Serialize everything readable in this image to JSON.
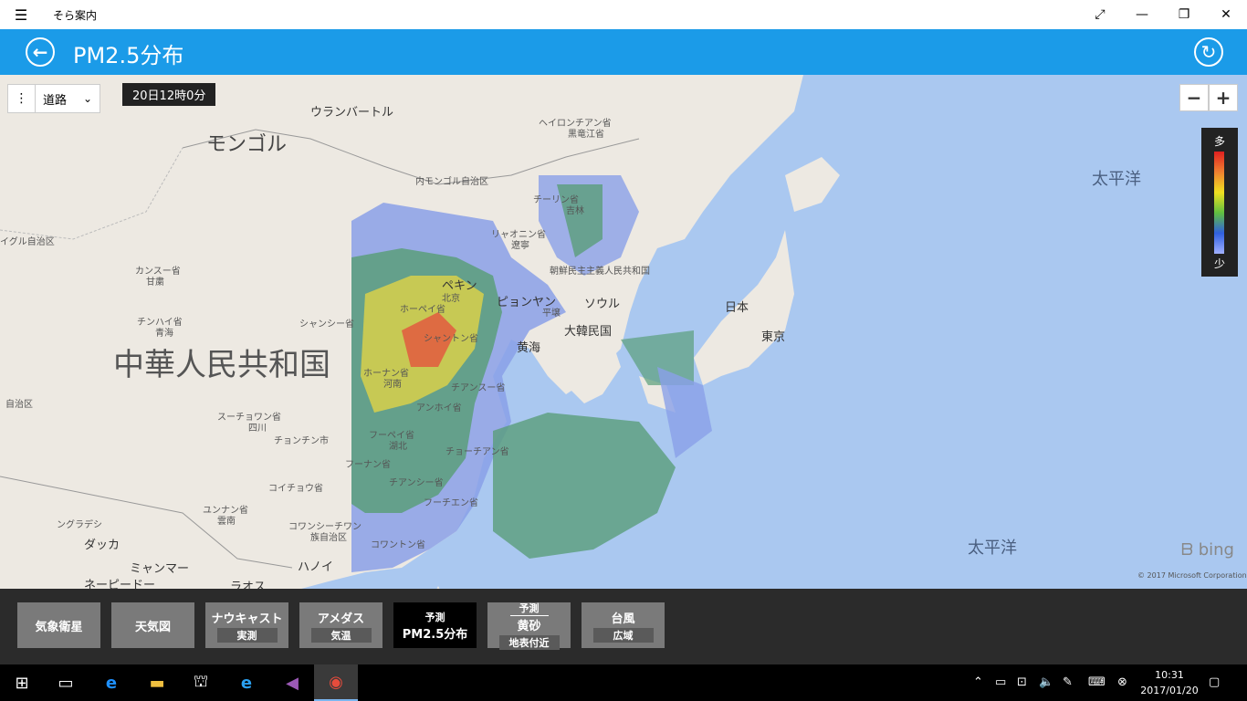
{
  "titlebar": {
    "app_name": "そら案内",
    "menu_icon": "hamburger-icon"
  },
  "header": {
    "title": "PM2.5分布"
  },
  "map": {
    "layer_select": "道路",
    "timestamp": "20日12時0分",
    "zoom_out": "−",
    "zoom_in": "+",
    "legend": {
      "high": "多",
      "low": "少"
    },
    "bing": "bing",
    "copyright": "© 2017 Microsoft Corporation",
    "labels": {
      "mongolia": "モンゴル",
      "ulaanbaatar": "ウランバートル",
      "heilongjiang": "ヘイロンチアン省",
      "heilongjiang_zh": "黒竜江省",
      "inner_mongolia": "内モンゴル自治区",
      "xinjiang": "イグル自治区",
      "gansu": "カンスー省",
      "gansu_zh": "甘粛",
      "qinghai": "チンハイ省",
      "qinghai_zh": "青海",
      "shanxi": "シャンシー省",
      "china": "中華人民共和国",
      "tibet": "自治区",
      "sichuan": "スーチョワン省",
      "sichuan_zh": "四川",
      "chongqing": "チョンチン市",
      "guizhou": "コイチョウ省",
      "yunnan": "ユンナン省",
      "yunnan_zh": "雲南",
      "guangxi": "コワンシーチワン",
      "guangxi_zh": "族自治区",
      "guangdong": "コワントン省",
      "bangladesh": "ングラデシ",
      "dhaka": "ダッカ",
      "myanmar": "ミャンマー",
      "naypyidaw": "ネーピードー",
      "laos": "ラオス",
      "hanoi": "ハノイ",
      "jilin": "チーリン省",
      "jilin_zh": "吉林",
      "liaoning": "リャオニン省",
      "liaoning_zh": "遼寧",
      "nkorea": "朝鮮民主主義人民共和国",
      "beijing": "ペキン",
      "beijing_zh": "北京",
      "hebei": "ホーペイ省",
      "pyongyang": "ピョンヤン",
      "pyongyang_zh": "平壌",
      "seoul": "ソウル",
      "skorea": "大韓民国",
      "shandong": "シャントン省",
      "yellow_sea": "黄海",
      "henan": "ホーナン省",
      "henan_zh": "河南",
      "jiangsu": "チアンスー省",
      "anhui": "アンホイ省",
      "hubei": "フーペイ省",
      "hubei_zh": "湖北",
      "zhejiang": "チョーチアン省",
      "hunan": "フーナン省",
      "jiangxi": "チアンシー省",
      "fujian": "フーチエン省",
      "japan": "日本",
      "tokyo": "東京",
      "pacific1": "太平洋",
      "pacific2": "太平洋"
    }
  },
  "nav": [
    {
      "label": "気象衛星",
      "pre": "",
      "sub": ""
    },
    {
      "label": "天気図",
      "pre": "",
      "sub": ""
    },
    {
      "label": "ナウキャスト",
      "pre": "",
      "sub": "実測"
    },
    {
      "label": "アメダス",
      "pre": "",
      "sub": "気温"
    },
    {
      "label": "PM2.5分布",
      "pre": "予測",
      "sub": ""
    },
    {
      "label": "黄砂",
      "pre": "予測",
      "sub": "地表付近"
    },
    {
      "label": "台風",
      "pre": "",
      "sub": "広域"
    }
  ],
  "taskbar": {
    "time": "10:31",
    "date": "2017/01/20"
  },
  "colors": {
    "header": "#1b9be8",
    "active_nav": "#000000",
    "nav": "#7a7a7a"
  }
}
